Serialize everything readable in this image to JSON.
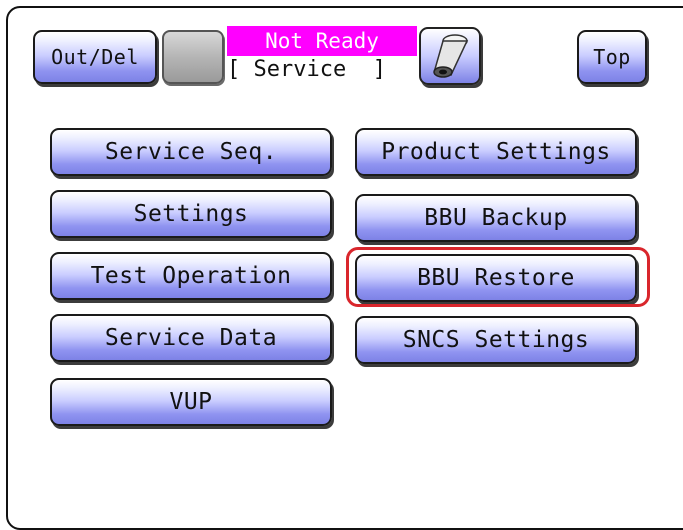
{
  "header": {
    "out_del_label": "Out/Del",
    "status_line1": "Not Ready",
    "status_line2": "[ Service  ]",
    "top_label": "Top"
  },
  "menu": {
    "service_seq": "Service Seq.",
    "product_settings": "Product Settings",
    "settings": "Settings",
    "bbu_backup": "BBU Backup",
    "test_operation": "Test Operation",
    "bbu_restore": "BBU Restore",
    "service_data": "Service Data",
    "sncs_settings": "SNCS Settings",
    "vup": "VUP"
  },
  "icons": {
    "toner": "toner-bottle-icon"
  },
  "colors": {
    "button_blue": "#8f93f0",
    "status_magenta": "#ff00ff",
    "highlight_red": "#d9262c"
  }
}
